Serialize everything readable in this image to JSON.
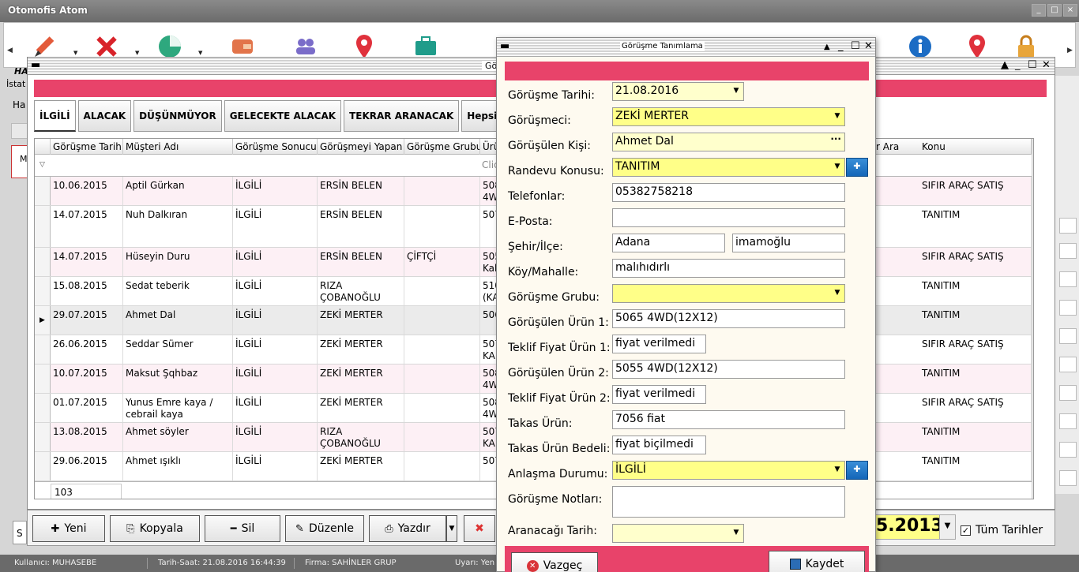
{
  "app": {
    "title": "Otomofis Atom"
  },
  "behind": {
    "tab_label": "İstat",
    "sub_label": "Ha",
    "ha_label": "HA",
    "left_m": "M",
    "left_s": "S"
  },
  "grid_window": {
    "title": "Görüşme"
  },
  "filter_tabs": [
    "İLGİLİ",
    "ALACAK",
    "DÜŞÜNMÜYOR",
    "GELECEKTE ALACAK",
    "TEKRAR ARANACAK",
    "Hepsi"
  ],
  "grid": {
    "columns": [
      "Görüşme Tarih",
      "Müşteri Adı",
      "Görüşme Sonucu",
      "Görüşmeyi Yapan",
      "Görüşme Grubu",
      "Ürü",
      "r Ara",
      "Konu"
    ],
    "filter_hint": "Click",
    "rows": [
      {
        "date": "10.06.2015",
        "customer": "Aptil Gürkan",
        "result": "İLGİLİ",
        "by": "ERSİN BELEN",
        "group": "",
        "product": "508 4W",
        "topic": "SIFIR ARAÇ SATIŞ"
      },
      {
        "date": "14.07.2015",
        "customer": "Nuh Dalkıran",
        "result": "İLGİLİ",
        "by": "ERSİN BELEN",
        "group": "",
        "product": "507",
        "topic": "TANITIM"
      },
      {
        "date": "14.07.2015",
        "customer": "Hüseyin Duru",
        "result": "İLGİLİ",
        "by": "ERSİN BELEN",
        "group": "ÇİFTÇİ",
        "product": "505 Kab",
        "topic": "SIFIR ARAÇ SATIŞ"
      },
      {
        "date": "15.08.2015",
        "customer": "Sedat teberik",
        "result": "İLGİLİ",
        "by": "RIZA ÇOBANOĞLU",
        "group": "",
        "product": "510 (KA",
        "topic": "TANITIM"
      },
      {
        "date": "29.07.2015",
        "customer": "Ahmet Dal",
        "result": "İLGİLİ",
        "by": "ZEKİ MERTER",
        "group": "",
        "product": "506",
        "topic": "TANITIM"
      },
      {
        "date": "26.06.2015",
        "customer": "Seddar Sümer",
        "result": "İLGİLİ",
        "by": "ZEKİ MERTER",
        "group": "",
        "product": "507 KAI",
        "topic": "SIFIR ARAÇ SATIŞ"
      },
      {
        "date": "10.07.2015",
        "customer": "Maksut Şqhbaz",
        "result": "İLGİLİ",
        "by": "ZEKİ MERTER",
        "group": "",
        "product": "508 4W",
        "topic": "TANITIM"
      },
      {
        "date": "01.07.2015",
        "customer": "Yunus Emre kaya / cebrail kaya",
        "result": "İLGİLİ",
        "by": "ZEKİ MERTER",
        "group": "",
        "product": "508 4W",
        "topic": "SIFIR ARAÇ SATIŞ"
      },
      {
        "date": "13.08.2015",
        "customer": "Ahmet söyler",
        "result": "İLGİLİ",
        "by": "RIZA ÇOBANOĞLU",
        "group": "",
        "product": "507 KAI",
        "topic": "TANITIM"
      },
      {
        "date": "29.06.2015",
        "customer": "Ahmet ışıklı",
        "result": "İLGİLİ",
        "by": "ZEKİ MERTER",
        "group": "",
        "product": "507",
        "topic": "TANITIM"
      }
    ],
    "footer_count": "103"
  },
  "actions": {
    "new": "Yeni",
    "copy": "Kopyala",
    "delete": "Sil",
    "edit": "Düzenle",
    "print": "Yazdır"
  },
  "date_filter": {
    "value": "5.2013",
    "all_dates_label": "Tüm Tarihler",
    "all_dates_checked": "✓"
  },
  "status": {
    "user": "Kullanıcı: MUHASEBE",
    "datetime": "Tarih-Saat: 21.08.2016 16:44:39",
    "firm": "Firma: SAHİNLER GRUP",
    "warning": "Uyarı: Yen"
  },
  "dialog": {
    "title": "Görüşme Tanımlama",
    "fields": {
      "date": {
        "label": "Görüşme Tarihi:",
        "value": "21.08.2016"
      },
      "interviewer": {
        "label": "Görüşmeci:",
        "value": "ZEKİ MERTER"
      },
      "person": {
        "label": "Görüşülen Kişi:",
        "value": "Ahmet Dal"
      },
      "topic": {
        "label": "Randevu Konusu:",
        "value": "TANITIM"
      },
      "phones": {
        "label": "Telefonlar:",
        "value": "05382758218"
      },
      "email": {
        "label": "E-Posta:",
        "value": ""
      },
      "city": {
        "label": "Şehir/İlçe:",
        "city": "Adana",
        "district": "imamoğlu"
      },
      "village": {
        "label": "Köy/Mahalle:",
        "value": "malıhıdırlı"
      },
      "group": {
        "label": "Görüşme Grubu:",
        "value": ""
      },
      "product1": {
        "label": "Görüşülen Ürün 1:",
        "value": "5065 4WD(12X12)"
      },
      "offer1": {
        "label": "Teklif Fiyat Ürün 1:",
        "value": "fiyat verilmedi"
      },
      "product2": {
        "label": "Görüşülen Ürün 2:",
        "value": "5055 4WD(12X12)"
      },
      "offer2": {
        "label": "Teklif Fiyat Ürün 2:",
        "value": "fiyat verilmedi"
      },
      "trade": {
        "label": "Takas Ürün:",
        "value": "7056 fiat"
      },
      "trade_value": {
        "label": "Takas Ürün Bedeli:",
        "value": "fiyat biçilmedi"
      },
      "deal": {
        "label": "Anlaşma Durumu:",
        "value": "İLGİLİ"
      },
      "notes": {
        "label": "Görüşme Notları:",
        "value": ""
      },
      "recall": {
        "label": "Aranacağı Tarih:",
        "value": ""
      }
    },
    "cancel_label": "Vazgeç",
    "save_label": "Kaydet"
  },
  "colors": {
    "accent_red": "#e8436a",
    "field_yellow": "#ffff88",
    "plus_blue": "#1466b8"
  },
  "icons": [
    "pencil-icon",
    "tools-icon",
    "pie-chart-icon",
    "wallet-icon",
    "users-icon",
    "location-pin-icon",
    "briefcase-icon",
    "info-icon",
    "lock-icon"
  ]
}
